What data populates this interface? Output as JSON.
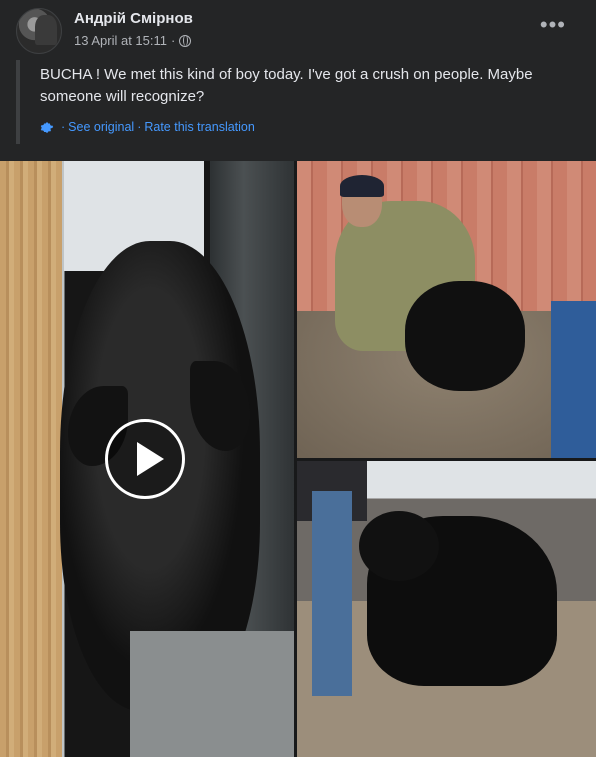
{
  "post": {
    "author": "Андрій Смірнов",
    "timestamp": "13 April at 15:11",
    "separator": "·",
    "more_label": "•••",
    "text": "BUCHA ! We met this kind of boy today. I've got a crush on people. Maybe someone will recognize?",
    "translation": {
      "see_original": "See original",
      "rate": "Rate this translation",
      "dot": "·"
    }
  },
  "icons": {
    "avatar": "avatar",
    "audience": "globe-icon",
    "translate": "gear-icon",
    "more": "more-options-icon",
    "play": "play-icon"
  },
  "colors": {
    "background": "#242526",
    "text": "#e4e6eb",
    "secondary_text": "#b0b3b8",
    "link": "#4599ff"
  }
}
